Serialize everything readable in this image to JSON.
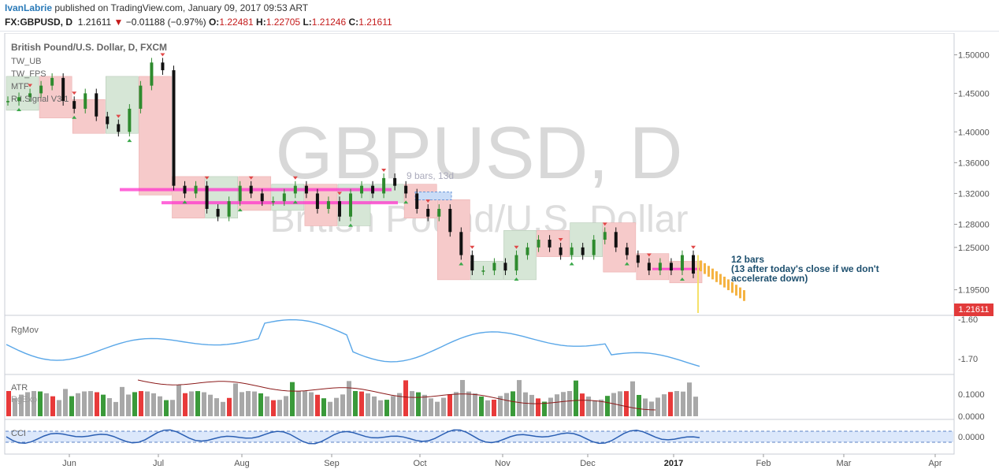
{
  "header": {
    "author": "IvanLabrie",
    "published_text": " published on TradingView.com, January 09, 2017 09:53 ART",
    "symbol": "FX:GBPUSD, D",
    "last": "1.21611",
    "change": "−0.01188 (−0.97%)",
    "o_label": "O:",
    "o_value": "1.22481",
    "h_label": "H:",
    "h_value": "1.22705",
    "l_label": "L:",
    "l_value": "1.21246",
    "c_label": "C:",
    "c_value": "1.21611"
  },
  "main": {
    "title": "British Pound/U.S. Dollar, D, FXCM",
    "indicators": [
      "TW_UB",
      "TW_FPS",
      "MTF",
      "R.I.Signal V3.1"
    ],
    "watermark_symbol": "GBPUSD, D",
    "watermark_name": "British Pound/U.S. Dollar",
    "annotation_bars": "9 bars, 13d",
    "note_lines": [
      "12 bars",
      "(13 after today's close if we don't",
      "accelerate down)"
    ],
    "price_ticks": [
      "1.50000",
      "1.45000",
      "1.40000",
      "1.36000",
      "1.32000",
      "1.28000",
      "1.25000",
      "1.19500"
    ],
    "last_price_tag": "1.21611"
  },
  "panes": {
    "rgmov": {
      "label": "RgMov",
      "ticks": [
        "-1.60",
        "-1.70"
      ]
    },
    "atr": {
      "labels": [
        "ATR",
        "RgExp"
      ],
      "ticks": [
        "0.1000",
        "0.0000"
      ]
    },
    "cci": {
      "label": "CCI",
      "ticks": [
        "0.0000"
      ]
    }
  },
  "xaxis": {
    "labels": [
      "Jun",
      "Jul",
      "Aug",
      "Sep",
      "Oct",
      "Nov",
      "Dec",
      "2017",
      "Feb",
      "Mar",
      "Apr"
    ]
  },
  "chart_data": {
    "type": "candlestick",
    "title": "British Pound/U.S. Dollar, D, FXCM",
    "y_range": [
      1.17,
      1.52
    ],
    "closes_approx": [
      1.44,
      1.445,
      1.45,
      1.46,
      1.47,
      1.44,
      1.43,
      1.45,
      1.42,
      1.41,
      1.4,
      1.43,
      1.46,
      1.49,
      1.48,
      1.33,
      1.32,
      1.33,
      1.3,
      1.29,
      1.31,
      1.33,
      1.32,
      1.31,
      1.31,
      1.32,
      1.33,
      1.32,
      1.3,
      1.31,
      1.29,
      1.32,
      1.33,
      1.32,
      1.34,
      1.33,
      1.32,
      1.3,
      1.29,
      1.3,
      1.27,
      1.24,
      1.22,
      1.22,
      1.23,
      1.22,
      1.24,
      1.25,
      1.26,
      1.25,
      1.24,
      1.25,
      1.24,
      1.26,
      1.27,
      1.25,
      1.24,
      1.23,
      1.22,
      1.23,
      1.22,
      1.24,
      1.216
    ],
    "colors": {
      "up": "#2e8b2e",
      "down": "#111111",
      "bull_box": "#d6e6d6",
      "bear_box": "#f6caca",
      "magenta": "#ff33cc",
      "forecast": "#f5b342",
      "rgmov_line": "#5aa7e8",
      "atr_line": "#8b1a1a",
      "cci_line": "#2b5fb3",
      "cci_band": "#dce8fb"
    }
  }
}
